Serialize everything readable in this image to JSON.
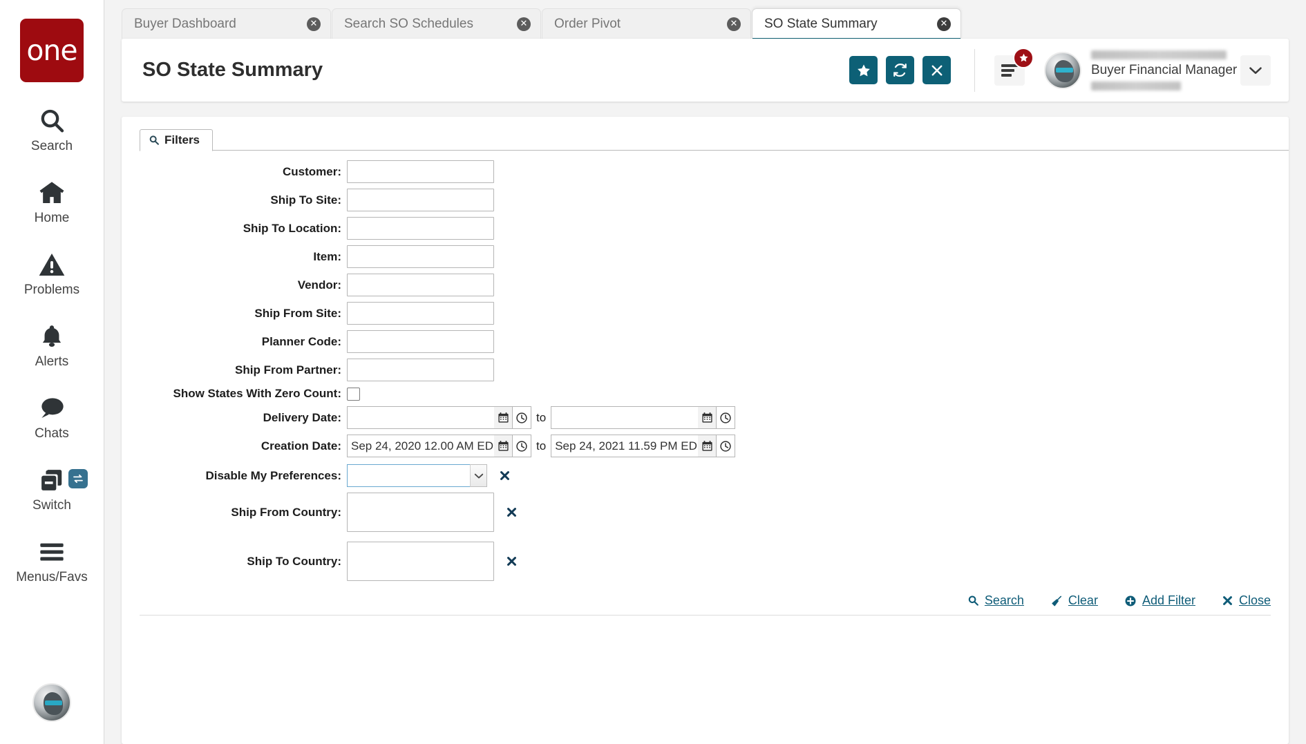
{
  "sidebar": {
    "logo_text": "one",
    "items": [
      {
        "label": "Search",
        "icon": "search-icon"
      },
      {
        "label": "Home",
        "icon": "home-icon"
      },
      {
        "label": "Problems",
        "icon": "warning-triangle-icon"
      },
      {
        "label": "Alerts",
        "icon": "bell-icon"
      },
      {
        "label": "Chats",
        "icon": "chat-bubble-icon"
      },
      {
        "label": "Switch",
        "icon": "windows-switch-icon",
        "badge_icon": "swap-arrows-icon"
      },
      {
        "label": "Menus/Favs",
        "icon": "hamburger-icon"
      }
    ],
    "avatar_icon": "user-avatar-icon"
  },
  "tabs": [
    {
      "label": "Buyer Dashboard",
      "active": false,
      "close_icon": "close-circle-icon"
    },
    {
      "label": "Search SO Schedules",
      "active": false,
      "close_icon": "close-circle-icon"
    },
    {
      "label": "Order Pivot",
      "active": false,
      "close_icon": "close-circle-icon"
    },
    {
      "label": "SO State Summary",
      "active": true,
      "close_icon": "close-circle-icon"
    }
  ],
  "header": {
    "title": "SO State Summary",
    "actions": [
      {
        "name": "favorite-button",
        "icon": "star-icon",
        "glyph": "★"
      },
      {
        "name": "refresh-button",
        "icon": "refresh-icon",
        "glyph": "⟳"
      },
      {
        "name": "close-button",
        "icon": "close-x-icon",
        "glyph": "✕"
      }
    ],
    "menu": {
      "icon": "hamburger-menu-icon",
      "badge_icon": "star-badge-icon",
      "badge_glyph": "★"
    },
    "user": {
      "avatar_icon": "user-avatar-icon",
      "name_redacted": "",
      "role": "Buyer Financial Manager",
      "company_redacted": "",
      "caret_icon": "chevron-down-icon",
      "caret_glyph": "❯"
    },
    "accent_color": "#0d6076",
    "badge_color": "#9e1016"
  },
  "filters_panel": {
    "tab_label": "Filters",
    "tab_icon": "search-icon",
    "fields": [
      {
        "id": "customer",
        "label": "Customer:",
        "type": "text",
        "value": ""
      },
      {
        "id": "ship-to-site",
        "label": "Ship To Site:",
        "type": "text",
        "value": ""
      },
      {
        "id": "ship-to-location",
        "label": "Ship To Location:",
        "type": "text",
        "value": ""
      },
      {
        "id": "item",
        "label": "Item:",
        "type": "text",
        "value": ""
      },
      {
        "id": "vendor",
        "label": "Vendor:",
        "type": "text",
        "value": ""
      },
      {
        "id": "ship-from-site",
        "label": "Ship From Site:",
        "type": "text",
        "value": ""
      },
      {
        "id": "planner-code",
        "label": "Planner Code:",
        "type": "text",
        "value": ""
      },
      {
        "id": "ship-from-partner",
        "label": "Ship From Partner:",
        "type": "text",
        "value": ""
      },
      {
        "id": "show-states-zero",
        "label": "Show States With Zero Count:",
        "type": "checkbox",
        "checked": false
      }
    ],
    "date_ranges": [
      {
        "id": "delivery-date",
        "label": "Delivery Date:",
        "from_value": "",
        "to_value": "",
        "separator": "to",
        "calendar_icon": "calendar-icon",
        "clock_icon": "clock-icon"
      },
      {
        "id": "creation-date",
        "label": "Creation Date:",
        "from_value": "Sep 24, 2020 12.00 AM ED",
        "to_value": "Sep 24, 2021 11.59 PM ED",
        "separator": "to",
        "calendar_icon": "calendar-icon",
        "clock_icon": "clock-icon"
      }
    ],
    "extra_fields": [
      {
        "id": "disable-my-preferences",
        "label": "Disable My Preferences:",
        "type": "select",
        "value": "",
        "remove_icon": "remove-filter-icon",
        "remove_glyph": "✖"
      },
      {
        "id": "ship-from-country",
        "label": "Ship From Country:",
        "type": "textarea",
        "value": "",
        "remove_icon": "remove-filter-icon",
        "remove_glyph": "✖"
      },
      {
        "id": "ship-to-country",
        "label": "Ship To Country:",
        "type": "textarea",
        "value": "",
        "remove_icon": "remove-filter-icon",
        "remove_glyph": "✖"
      }
    ],
    "footer_links": [
      {
        "id": "search",
        "label": "Search",
        "icon": "search-icon"
      },
      {
        "id": "clear",
        "label": "Clear",
        "icon": "broom-icon"
      },
      {
        "id": "add-filter",
        "label": "Add Filter",
        "icon": "plus-circle-icon"
      },
      {
        "id": "close",
        "label": "Close",
        "icon": "close-x-icon"
      }
    ],
    "link_color": "#0f5c78"
  }
}
